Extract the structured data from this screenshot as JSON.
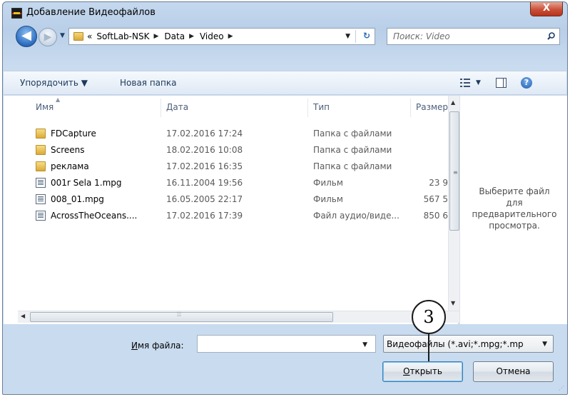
{
  "window": {
    "title": "Добавление Видеофайлов",
    "close_label": "X"
  },
  "nav": {
    "back_glyph": "◀",
    "forward_glyph": "▶",
    "breadcrumb_prefix": "«",
    "breadcrumbs": [
      "SoftLab-NSK",
      "Data",
      "Video"
    ],
    "search_placeholder": "Поиск: Video"
  },
  "toolbar": {
    "organize_label": "Упорядочить ▼",
    "new_folder_label": "Новая папка",
    "help_label": "?"
  },
  "columns": {
    "name": "Имя",
    "date": "Дата",
    "type": "Тип",
    "size": "Размер"
  },
  "files": [
    {
      "name": "FDCapture",
      "date": "17.02.2016 17:24",
      "type": "Папка с файлами",
      "size": "",
      "icon": "folder-icon"
    },
    {
      "name": "Screens",
      "date": "18.02.2016 10:08",
      "type": "Папка с файлами",
      "size": "",
      "icon": "folder-icon"
    },
    {
      "name": "реклама",
      "date": "17.02.2016 16:35",
      "type": "Папка с файлами",
      "size": "",
      "icon": "folder-icon"
    },
    {
      "name": "001r Sela 1.mpg",
      "date": "16.11.2004 19:56",
      "type": "Фильм",
      "size": "23 9",
      "icon": "video-file-icon"
    },
    {
      "name": "008_01.mpg",
      "date": "16.05.2005 22:17",
      "type": "Фильм",
      "size": "567 5",
      "icon": "video-file-icon"
    },
    {
      "name": "AcrossTheOceans....",
      "date": "17.02.2016 17:39",
      "type": "Файл аудио/виде...",
      "size": "850 6",
      "icon": "video-file-icon"
    }
  ],
  "preview": {
    "message_line1": "Выберите файл",
    "message_line2": "для",
    "message_line3": "предварительного",
    "message_line4": "просмотра."
  },
  "bottom": {
    "filename_label_u": "И",
    "filename_label_rest": "мя файла:",
    "filename_value": "",
    "filter_value": "Видеофайлы (*.avi;*.mpg;*.mp",
    "open_u": "О",
    "open_rest": "ткрыть",
    "cancel_label": "Отмена"
  },
  "callout": {
    "number": "3"
  },
  "colors": {
    "accent": "#2a6cc0",
    "close": "#c8503a",
    "title_bg": "#b9cfe8"
  }
}
